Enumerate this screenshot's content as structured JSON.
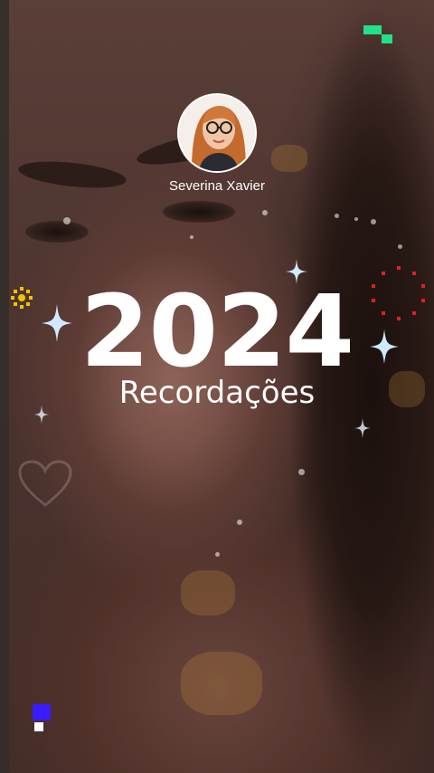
{
  "user": {
    "name": "Severina Xavier"
  },
  "title": {
    "year": "2024",
    "subtitle": "Recordações"
  },
  "colors": {
    "text": "#ffffff",
    "sparkle": "#bfe6ff",
    "ring_red": "#e02020",
    "sun_yellow": "#f2c300",
    "pixel_green": "#22e08a",
    "pixel_blue": "#3a1cff"
  },
  "icons": [
    "sparkle-icon",
    "red-dot-ring-icon",
    "yellow-sun-icon",
    "green-pixel-icon",
    "blue-pixel-icon",
    "heart-icon"
  ]
}
